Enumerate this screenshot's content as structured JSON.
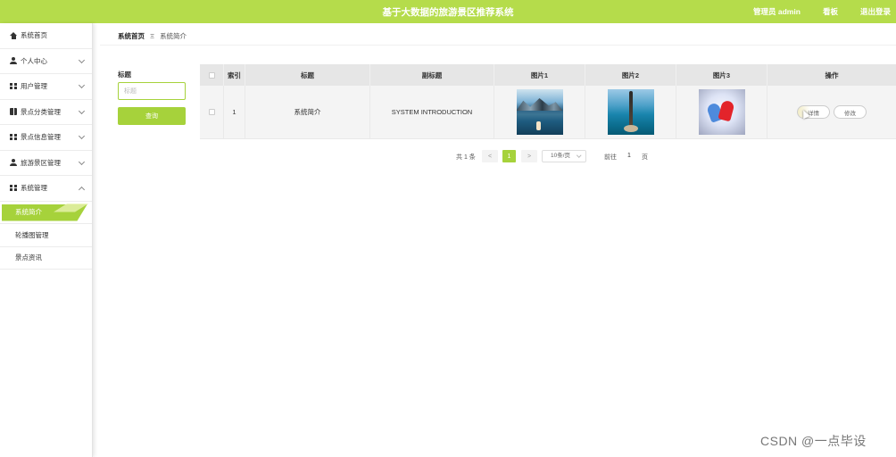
{
  "header": {
    "title": "基于大数据的旅游景区推荐系统",
    "admin_label": "管理员 admin",
    "dashboard_label": "看板",
    "logout_label": "退出登录"
  },
  "sidebar": {
    "items": [
      {
        "label": "系统首页",
        "icon": "home-icon"
      },
      {
        "label": "个人中心",
        "icon": "user-icon"
      },
      {
        "label": "用户管理",
        "icon": "grid-icon"
      },
      {
        "label": "景点分类管理",
        "icon": "book-icon"
      },
      {
        "label": "景点信息管理",
        "icon": "grid-icon"
      },
      {
        "label": "旅游景区管理",
        "icon": "user-icon"
      },
      {
        "label": "系统管理",
        "icon": "grid-icon"
      }
    ],
    "sub_items": [
      {
        "label": "系统简介",
        "active": true
      },
      {
        "label": "轮播图管理",
        "active": false
      },
      {
        "label": "景点资讯",
        "active": false
      }
    ]
  },
  "breadcrumb": {
    "home": "系统首页",
    "separator": "Ξ",
    "current": "系统简介"
  },
  "search": {
    "label": "标题",
    "placeholder": "标题",
    "button_label": "查询"
  },
  "table": {
    "columns": [
      "",
      "索引",
      "标题",
      "副标题",
      "图片1",
      "图片2",
      "图片3",
      "操作"
    ],
    "rows": [
      {
        "index": "1",
        "title": "系统简介",
        "subtitle": "SYSTEM INTRODUCTION",
        "images": [
          "mountain-lake-photo",
          "pier-sea-photo",
          "heart-balloons-photo"
        ],
        "actions": {
          "detail": "详情",
          "edit": "修改"
        }
      }
    ]
  },
  "pagination": {
    "total": "共 1 条",
    "prev": "<",
    "current_page": "1",
    "next": ">",
    "page_size": "10条/页",
    "goto_label": "前往",
    "goto_value": "1",
    "page_unit": "页"
  },
  "watermark": "CSDN @一点毕设",
  "colors": {
    "accent": "#a6d23b",
    "header": "#b5dc4b"
  }
}
